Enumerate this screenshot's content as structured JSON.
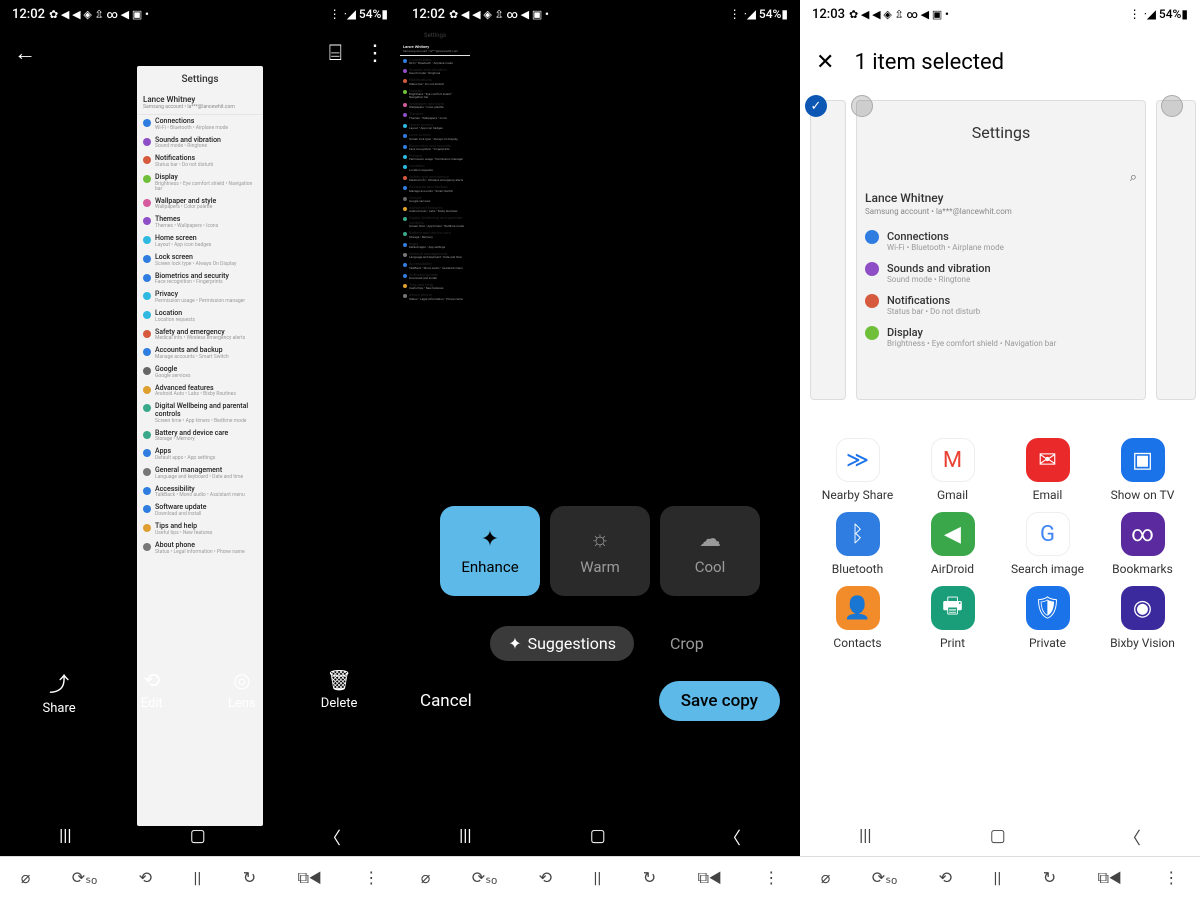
{
  "status": {
    "time_a": "12:02",
    "time_b": "12:03",
    "icons": "✿ ◀ ◀ ◈ ⇫ ∞ ◀ ▣ •",
    "signal": "⋮ ᐧ◢ 54%▮"
  },
  "settings_title": "Settings",
  "user": {
    "name": "Lance Whitney",
    "sub": "Samsung account • la***@lancewhit.com"
  },
  "settings_items": [
    {
      "title": "Connections",
      "sub": "Wi-Fi • Bluetooth • Airplane mode",
      "color": "#2f7de1"
    },
    {
      "title": "Sounds and vibration",
      "sub": "Sound mode • Ringtone",
      "color": "#8e4ec6"
    },
    {
      "title": "Notifications",
      "sub": "Status bar • Do not disturb",
      "color": "#d65a3e"
    },
    {
      "title": "Display",
      "sub": "Brightness • Eye comfort shield • Navigation bar",
      "color": "#6fbf3a"
    },
    {
      "title": "Wallpaper and style",
      "sub": "Wallpapers • Color palette",
      "color": "#d65a9e"
    },
    {
      "title": "Themes",
      "sub": "Themes • Wallpapers • Icons",
      "color": "#8e4ec6"
    },
    {
      "title": "Home screen",
      "sub": "Layout • App icon badges",
      "color": "#2fb9e1"
    },
    {
      "title": "Lock screen",
      "sub": "Screen lock type • Always On Display",
      "color": "#2f7de1"
    },
    {
      "title": "Biometrics and security",
      "sub": "Face recognition • Fingerprints",
      "color": "#2f7de1"
    },
    {
      "title": "Privacy",
      "sub": "Permission usage • Permission manager",
      "color": "#2fb9e1"
    },
    {
      "title": "Location",
      "sub": "Location requests",
      "color": "#2fb9e1"
    },
    {
      "title": "Safety and emergency",
      "sub": "Medical info • Wireless emergency alerts",
      "color": "#d65a3e"
    },
    {
      "title": "Accounts and backup",
      "sub": "Manage accounts • Smart Switch",
      "color": "#2f7de1"
    },
    {
      "title": "Google",
      "sub": "Google services",
      "color": "#666"
    },
    {
      "title": "Advanced features",
      "sub": "Android Auto • Labs • Bixby Routines",
      "color": "#e0a030"
    },
    {
      "title": "Digital Wellbeing and parental controls",
      "sub": "Screen time • App timers • Bedtime mode",
      "color": "#3aa88a"
    },
    {
      "title": "Battery and device care",
      "sub": "Storage • Memory",
      "color": "#3aa88a"
    },
    {
      "title": "Apps",
      "sub": "Default apps • App settings",
      "color": "#2f7de1"
    },
    {
      "title": "General management",
      "sub": "Language and keyboard • Date and time",
      "color": "#777"
    },
    {
      "title": "Accessibility",
      "sub": "TalkBack • Mono audio • Assistant menu",
      "color": "#2f7de1"
    },
    {
      "title": "Software update",
      "sub": "Download and install",
      "color": "#2f7de1"
    },
    {
      "title": "Tips and help",
      "sub": "Useful tips • New features",
      "color": "#e0a030"
    },
    {
      "title": "About phone",
      "sub": "Status • Legal information • Phone name",
      "color": "#777"
    }
  ],
  "p1": {
    "actions": {
      "share": "Share",
      "edit": "Edit",
      "lens": "Lens",
      "delete": "Delete"
    }
  },
  "p2": {
    "fx": {
      "enhance": "Enhance",
      "warm": "Warm",
      "cool": "Cool"
    },
    "tabs": {
      "suggestions": "Suggestions",
      "crop": "Crop"
    },
    "cancel": "Cancel",
    "save": "Save copy"
  },
  "p3": {
    "selected": "1 item selected",
    "share_targets_row1": [
      {
        "label": "Nearby Share",
        "color": "#fff",
        "fg": "#1a73e8",
        "ico": "≫"
      },
      {
        "label": "Gmail",
        "color": "#fff",
        "fg": "#ea4335",
        "ico": "M"
      },
      {
        "label": "Email",
        "color": "#ea2a2a",
        "fg": "#fff",
        "ico": "✉"
      },
      {
        "label": "Show on TV",
        "color": "#1a73e8",
        "fg": "#fff",
        "ico": "▣"
      }
    ],
    "share_targets_row2": [
      {
        "label": "Bluetooth",
        "color": "#2f7de1",
        "fg": "#fff",
        "ico": "ᛒ"
      },
      {
        "label": "AirDroid",
        "color": "#3aa84a",
        "fg": "#fff",
        "ico": "◀"
      },
      {
        "label": "Search image",
        "color": "#fff",
        "fg": "#4285f4",
        "ico": "G"
      },
      {
        "label": "Bookmarks",
        "color": "#5b2a9e",
        "fg": "#fff",
        "ico": "∞"
      }
    ],
    "share_targets_row3": [
      {
        "label": "Contacts",
        "color": "#f28b2a",
        "fg": "#fff",
        "ico": "👤"
      },
      {
        "label": "Print",
        "color": "#1a9e7a",
        "fg": "#fff",
        "ico": "🖶"
      },
      {
        "label": "Private",
        "color": "#1a73e8",
        "fg": "#fff",
        "ico": "🛡"
      },
      {
        "label": "Bixby Vision",
        "color": "#3a2a9e",
        "fg": "#fff",
        "ico": "◉"
      }
    ]
  },
  "nav": {
    "recents": "|||",
    "home": "▢",
    "back": "〈"
  },
  "toolrow": [
    "⌀",
    "⟳ₛₒ",
    "⟲",
    "||",
    "↻",
    "⧉◀",
    "⋮"
  ]
}
